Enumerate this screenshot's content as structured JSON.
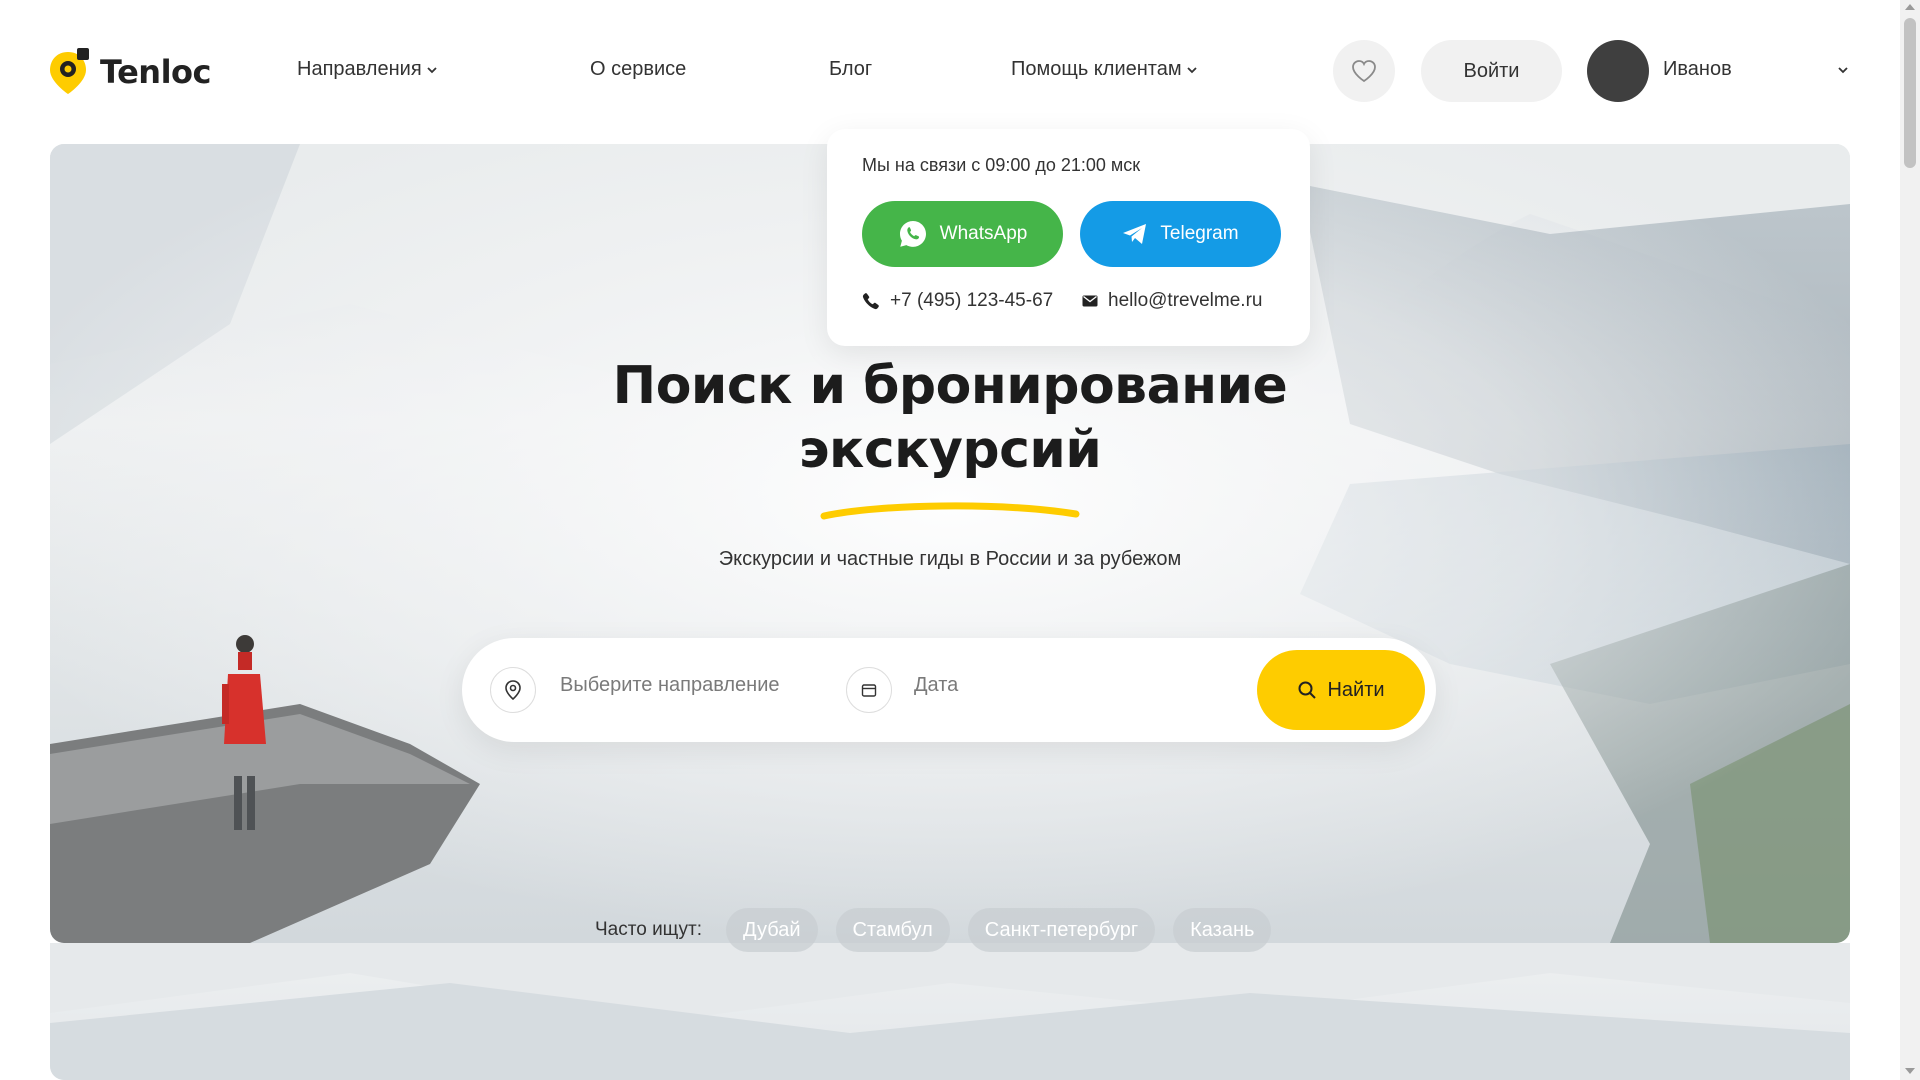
{
  "header": {
    "logo_text": "Tenloc",
    "nav": [
      {
        "label": "Направления"
      },
      {
        "label": "О сервисе"
      },
      {
        "label": "Блог"
      },
      {
        "label": "Помощь клиентам"
      }
    ],
    "login_label": "Войти",
    "username": "Иванов"
  },
  "support_dropdown": {
    "hours": "Мы на связи с 09:00 до 21:00 мск",
    "whatsapp_label": "WhatsApp",
    "telegram_label": "Telegram",
    "phone": "+7 (495) 123-45-67",
    "email": "hello@trevelme.ru",
    "colors": {
      "whatsapp": "#45b549",
      "telegram": "#149be6"
    }
  },
  "hero": {
    "title_line1": "Поиск и бронирование",
    "title_line2": "экскурсий",
    "subtitle": "Экскурсии и частные гиды в России и за рубежом"
  },
  "search": {
    "direction_placeholder": "Выберите направление",
    "date_placeholder": "Дата",
    "submit_label": "Найти",
    "accent_color": "#fecc00"
  },
  "popular": {
    "label": "Часто ищут:",
    "chips": [
      "Дубай",
      "Стамбул",
      "Санкт-петербург",
      "Казань"
    ]
  },
  "icons": [
    "logo-pin-icon",
    "chevron-down-icon",
    "heart-icon",
    "whatsapp-icon",
    "telegram-icon",
    "phone-icon",
    "mail-icon",
    "location-pin-icon",
    "calendar-icon",
    "search-icon"
  ]
}
